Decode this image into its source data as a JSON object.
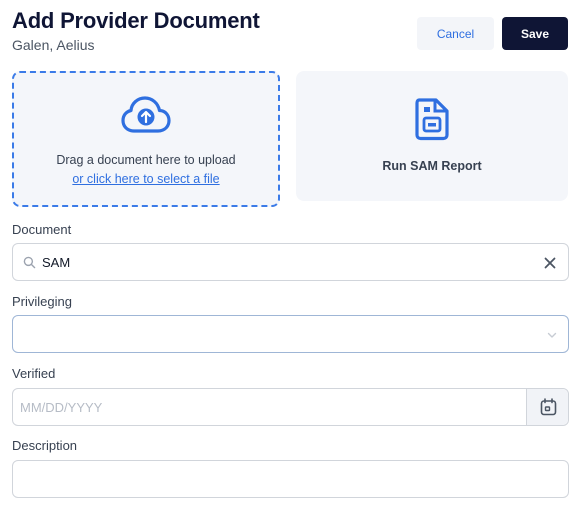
{
  "header": {
    "title": "Add Provider Document",
    "subtitle": "Galen, Aelius",
    "cancel_label": "Cancel",
    "save_label": "Save"
  },
  "upload": {
    "text": "Drag a document here to upload",
    "link": "or click here to select a file",
    "icon": "cloud-upload-icon"
  },
  "sam": {
    "label": "Run SAM Report",
    "icon": "document-report-icon"
  },
  "fields": {
    "document": {
      "label": "Document",
      "value": "SAM"
    },
    "privileging": {
      "label": "Privileging",
      "value": ""
    },
    "verified": {
      "label": "Verified",
      "placeholder": "MM/DD/YYYY"
    },
    "description": {
      "label": "Description",
      "value": ""
    }
  },
  "colors": {
    "accent": "#2f6fe0",
    "primary": "#0f1535",
    "panel": "#f4f6fa"
  }
}
